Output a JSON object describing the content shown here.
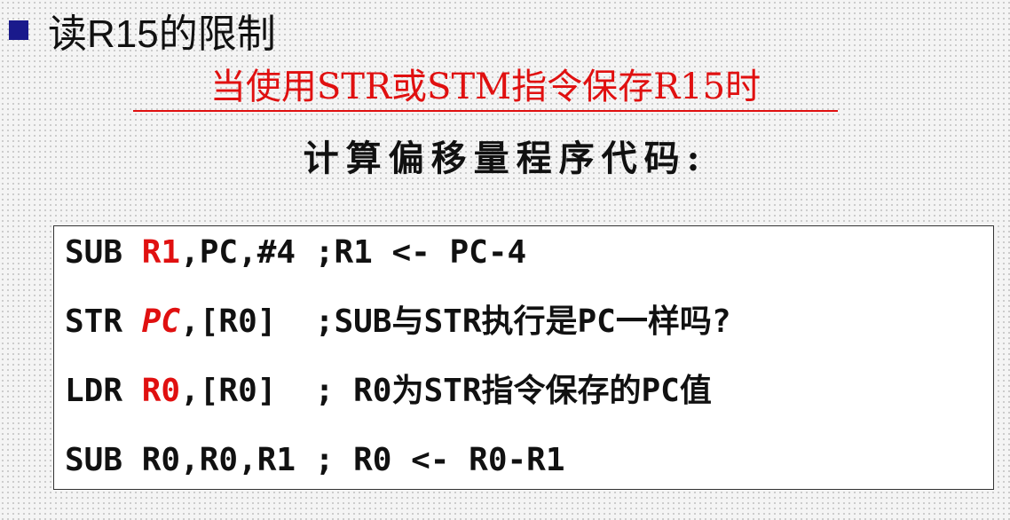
{
  "slide": {
    "bullet_color": "#1a1a8c",
    "heading": "读R15的限制",
    "subtitle": "当使用STR或STM指令保存R15时",
    "caption": "计算偏移量程序代码:"
  },
  "code": {
    "lines": [
      {
        "op": "SUB ",
        "reg": "R1",
        "rest": ",PC,#4 ;R1 <- PC-4"
      },
      {
        "op": "STR ",
        "reg": "PC",
        "rest": ",[R0]  ;SUB与STR执行是PC一样吗?"
      },
      {
        "op": "LDR ",
        "reg": "R0",
        "rest": ",[R0]  ; R0为STR指令保存的PC值"
      },
      {
        "op": "SUB R0,R0,R1 ; R0 <- R0-R1"
      }
    ],
    "highlight_color": "#e01010"
  }
}
